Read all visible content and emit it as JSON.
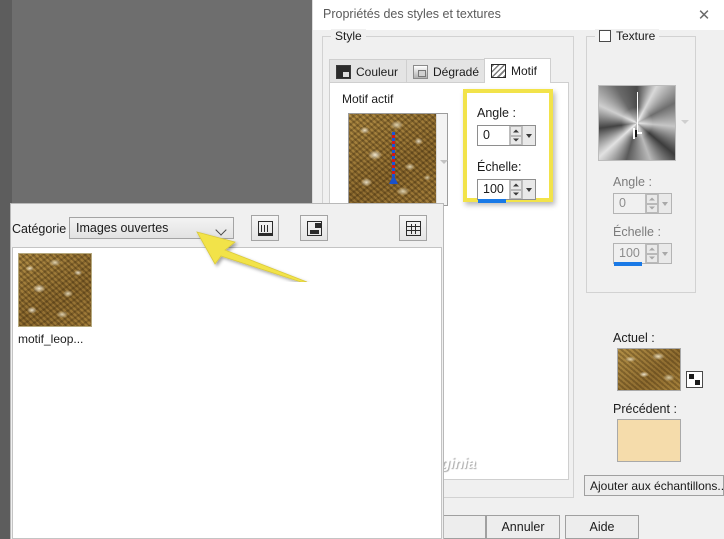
{
  "dialog": {
    "title": "Propriétés des styles et textures",
    "close_icon": "close-icon"
  },
  "style_group": {
    "legend": "Style",
    "tabs": [
      {
        "label": "Couleur",
        "icon": "color-swatch-icon",
        "active": false
      },
      {
        "label": "Dégradé",
        "icon": "gradient-icon",
        "active": false
      },
      {
        "label": "Motif",
        "icon": "pattern-icon",
        "active": true
      }
    ],
    "motif_actif_label": "Motif actif",
    "angle_label": "Angle :",
    "angle_value": "0",
    "echelle_label": "Échelle:",
    "echelle_value": "100"
  },
  "texture_group": {
    "legend": "Texture",
    "checked": false,
    "angle_label": "Angle :",
    "angle_value": "0",
    "echelle_label": "Échelle :",
    "echelle_value": "100"
  },
  "swatches": {
    "actuel_label": "Actuel :",
    "precedent_label": "Précédent :",
    "actuel_color": "#a07c38",
    "precedent_color": "#f5dcab",
    "transparency_icon": "checker-transparency-icon"
  },
  "buttons": {
    "add_samples": "Ajouter aux échantillons...",
    "ok": "",
    "cancel": "Annuler",
    "help": "Aide"
  },
  "picker": {
    "category_label": "Catégorie :",
    "category_value": "Images ouvertes",
    "toolbar": [
      {
        "name": "open-library-icon"
      },
      {
        "name": "save-library-icon"
      },
      {
        "name": "grid-view-icon"
      }
    ],
    "items": [
      {
        "label": "motif_leop...",
        "thumbnail": "leopard-pattern"
      }
    ]
  },
  "annotations": {
    "arrow_color": "#f2e34a",
    "highlight_color": "#f2e34a",
    "watermark": "© Créations Virginia"
  }
}
